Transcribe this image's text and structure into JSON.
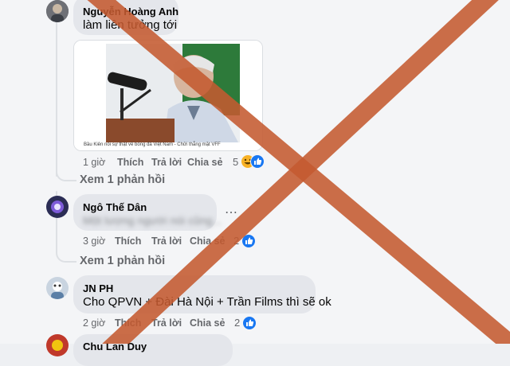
{
  "comments": [
    {
      "author": "Nguyễn Hoàng Anh",
      "text": "làm liên tưởng tới",
      "link_caption": "Bầu Kiên nói sự thật về bóng đá Việt Nam - Chửi thẳng mặt VFF",
      "time": "1 giờ",
      "like_label": "Thích",
      "reply_label": "Trả lời",
      "share_label": "Chia sẻ",
      "reaction_count": "5",
      "reactions": [
        "haha-icon",
        "like-icon"
      ],
      "view_replies": "Xem 1 phản hồi"
    },
    {
      "author": "Ngô Thế Dân",
      "text": "Một lượng người nói cũng...",
      "time": "3 giờ",
      "like_label": "Thích",
      "reply_label": "Trả lời",
      "share_label": "Chia sẻ",
      "reaction_count": "2",
      "reactions": [
        "like-icon"
      ],
      "view_replies": "Xem 1 phản hồi"
    },
    {
      "author": "JN PH",
      "text": "Cho QPVN + Đài Hà Nội + Trần Films thì sẽ ok",
      "time": "2 giờ",
      "like_label": "Thích",
      "reply_label": "Trả lời",
      "share_label": "Chia sẻ",
      "reaction_count": "2",
      "reactions": [
        "like-icon"
      ]
    }
  ],
  "partial_author": "Chu Lan Duy",
  "colors": {
    "overlay_x": "#c45a30",
    "like_blue": "#1877f2",
    "bubble": "#e4e6eb",
    "meta_gray": "#65676b"
  }
}
